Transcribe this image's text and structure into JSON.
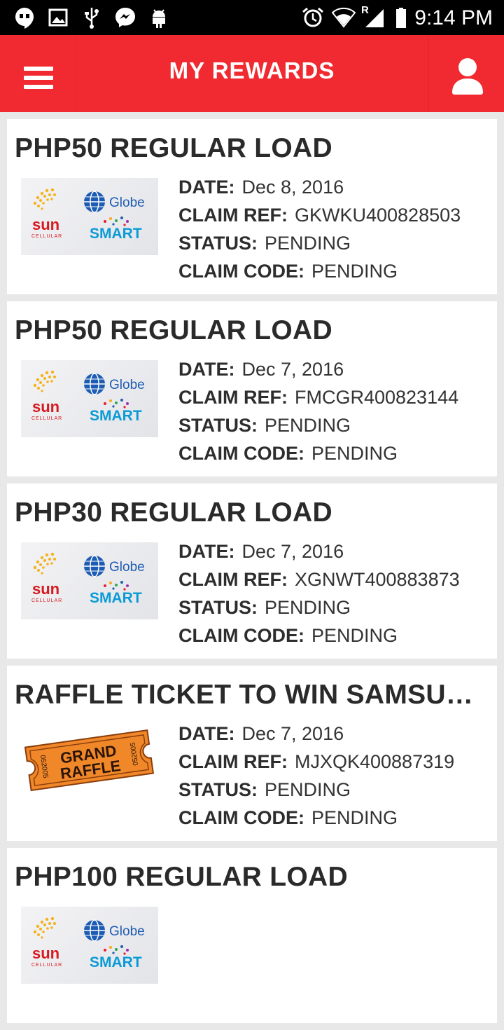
{
  "status_bar": {
    "time": "9:14 PM",
    "left_icons": [
      "hangouts-icon",
      "gallery-icon",
      "usb-icon",
      "messenger-icon",
      "android-icon"
    ],
    "right_icons": [
      "alarm-icon",
      "wifi-icon",
      "signal-icon",
      "battery-icon"
    ],
    "roaming_label": "R"
  },
  "app_bar": {
    "title": "MY REWARDS",
    "color": "#f02a30"
  },
  "labels": {
    "date": "DATE:",
    "claim_ref": "CLAIM REF:",
    "status": "STATUS:",
    "claim_code": "CLAIM CODE:"
  },
  "logos": {
    "sun": "sun",
    "sun_sub": "CELLULAR",
    "globe": "Globe",
    "smart": "SMART",
    "raffle_line1": "GRAND",
    "raffle_line2": "RAFFLE",
    "raffle_number": "052005"
  },
  "rewards": [
    {
      "title": "PHP50 REGULAR LOAD",
      "image": "telco-logos",
      "date": "Dec 8, 2016",
      "claim_ref": "GKWKU400828503",
      "status": "PENDING",
      "claim_code": "PENDING"
    },
    {
      "title": "PHP50 REGULAR LOAD",
      "image": "telco-logos",
      "date": "Dec 7, 2016",
      "claim_ref": "FMCGR400823144",
      "status": "PENDING",
      "claim_code": "PENDING"
    },
    {
      "title": "PHP30 REGULAR LOAD",
      "image": "telco-logos",
      "date": "Dec 7, 2016",
      "claim_ref": "XGNWT400883873",
      "status": "PENDING",
      "claim_code": "PENDING"
    },
    {
      "title": "RAFFLE TICKET TO WIN SAMSUNG ...",
      "image": "raffle-ticket",
      "date": "Dec 7, 2016",
      "claim_ref": "MJXQK400887319",
      "status": "PENDING",
      "claim_code": "PENDING"
    },
    {
      "title": "PHP100 REGULAR LOAD",
      "image": "telco-logos",
      "date": "",
      "claim_ref": "",
      "status": "",
      "claim_code": ""
    }
  ]
}
